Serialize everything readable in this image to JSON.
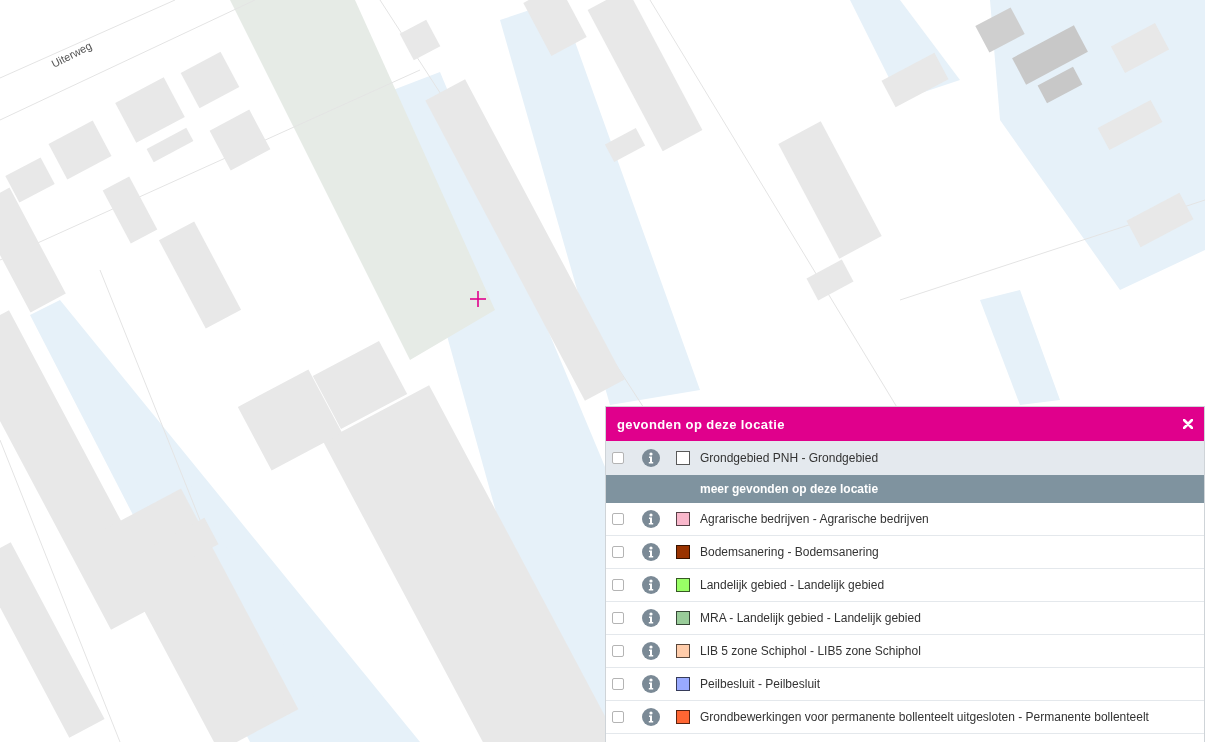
{
  "map": {
    "street_label": "Uiterweg"
  },
  "panel": {
    "title": "gevonden op deze locatie",
    "primary_item": {
      "label": "Grondgebied PNH - Grondgebied",
      "checked": false,
      "color": "#ffffff"
    },
    "section_label": "meer gevonden op deze locatie",
    "items": [
      {
        "label": "Agrarische bedrijven - Agrarische bedrijven",
        "checked": false,
        "color": "#f9b7cb"
      },
      {
        "label": "Bodemsanering - Bodemsanering",
        "checked": false,
        "color": "#993300"
      },
      {
        "label": "Landelijk gebied - Landelijk gebied",
        "checked": false,
        "color": "#99ff66"
      },
      {
        "label": "MRA - Landelijk gebied - Landelijk gebied",
        "checked": false,
        "color": "#99cc99"
      },
      {
        "label": "LIB 5 zone Schiphol - LIB5 zone Schiphol",
        "checked": false,
        "color": "#ffccaa"
      },
      {
        "label": "Peilbesluit - Peilbesluit",
        "checked": false,
        "color": "#99aaff"
      },
      {
        "label": "Grondbewerkingen voor permanente bollenteelt uitgesloten - Permanente bollenteelt",
        "checked": false,
        "color": "#ff6633"
      }
    ]
  }
}
